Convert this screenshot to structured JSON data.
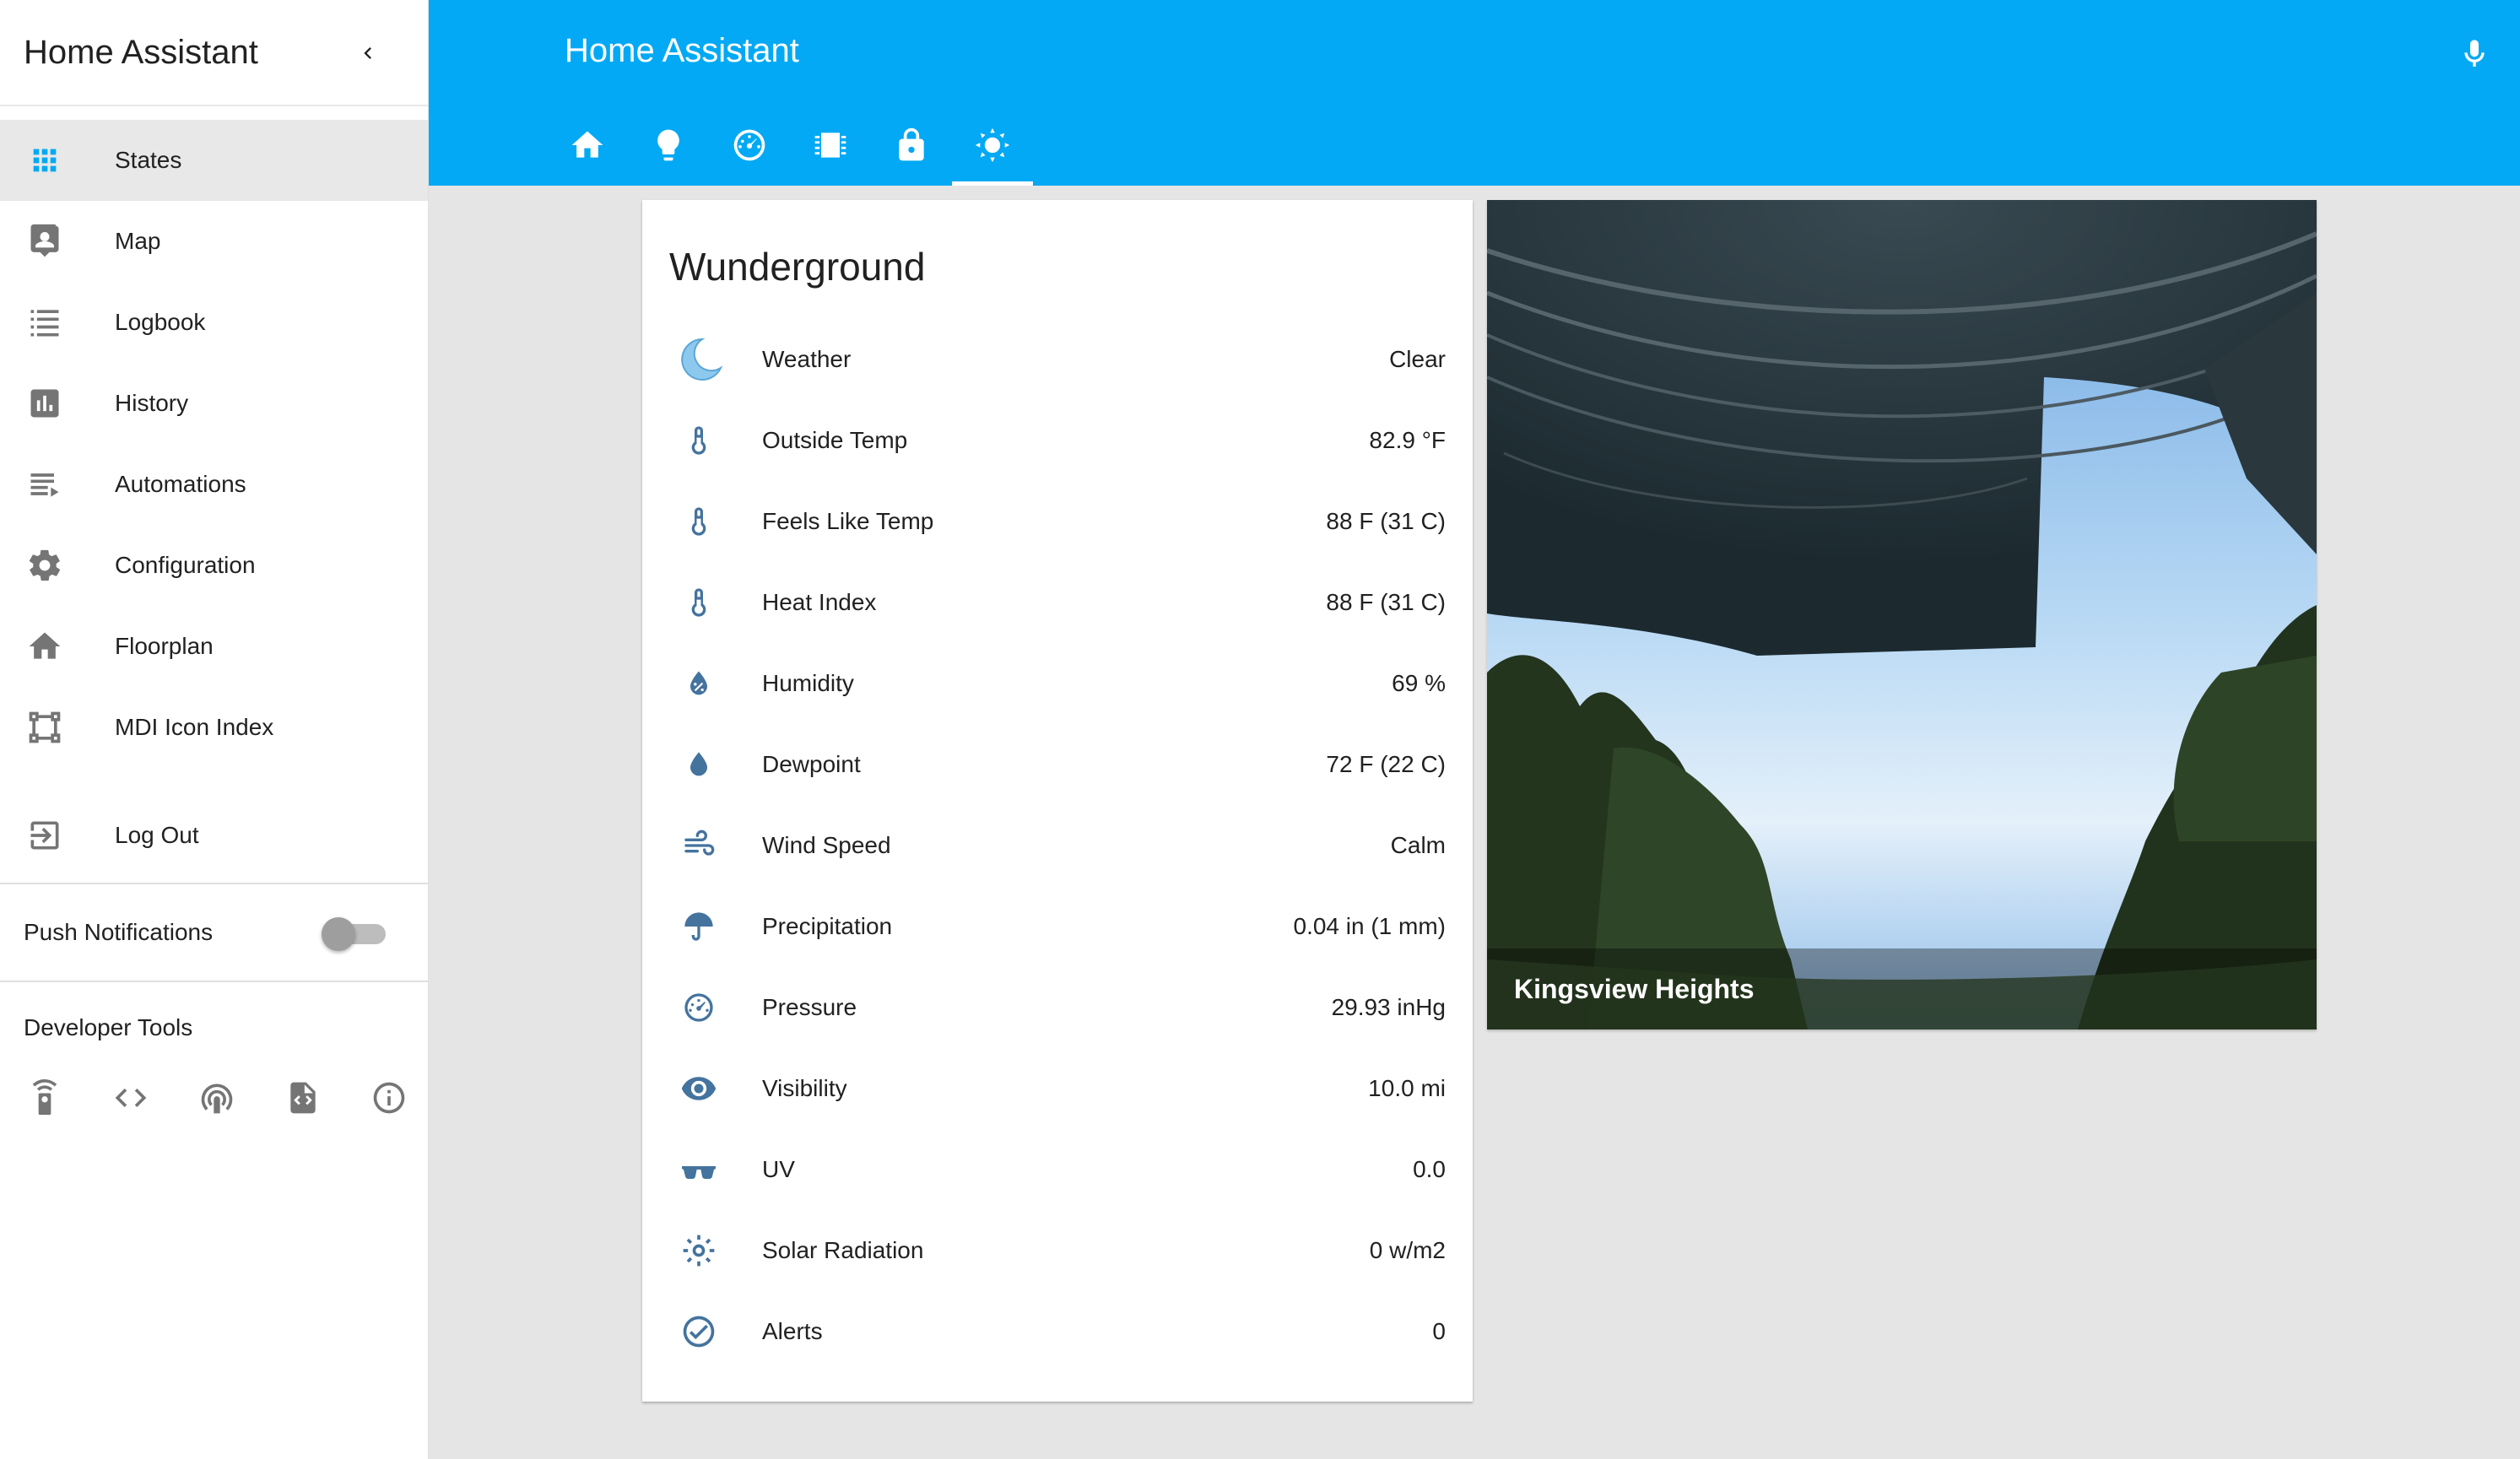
{
  "sidebar": {
    "title": "Home Assistant",
    "items": [
      {
        "label": "States",
        "icon": "apps-grid-icon",
        "active": true
      },
      {
        "label": "Map",
        "icon": "account-location-icon"
      },
      {
        "label": "Logbook",
        "icon": "format-list-bulleted-icon"
      },
      {
        "label": "History",
        "icon": "poll-box-icon"
      },
      {
        "label": "Automations",
        "icon": "playlist-play-icon"
      },
      {
        "label": "Configuration",
        "icon": "settings-gear-icon"
      },
      {
        "label": "Floorplan",
        "icon": "home-icon"
      },
      {
        "label": "MDI Icon Index",
        "icon": "vector-square-icon"
      }
    ],
    "logout_label": "Log Out",
    "push_label": "Push Notifications",
    "push_enabled": false,
    "dev_tools_title": "Developer Tools",
    "dev_tools": [
      "remote-icon",
      "code-tags-icon",
      "broadcast-icon",
      "file-xml-icon",
      "information-outline-icon"
    ]
  },
  "header": {
    "title": "Home Assistant",
    "tabs": [
      "home-icon",
      "lightbulb-icon",
      "speedometer-icon",
      "chip-icon",
      "lock-icon",
      "sun-icon"
    ],
    "active_tab": 5,
    "accent_color": "#03a9f4"
  },
  "card": {
    "title": "Wunderground",
    "rows": [
      {
        "label": "Weather",
        "value": "Clear",
        "icon": "moon-icon"
      },
      {
        "label": "Outside Temp",
        "value": "82.9 °F",
        "icon": "thermometer-icon"
      },
      {
        "label": "Feels Like Temp",
        "value": "88 F (31 C)",
        "icon": "thermometer-icon"
      },
      {
        "label": "Heat Index",
        "value": "88 F (31 C)",
        "icon": "thermometer-icon"
      },
      {
        "label": "Humidity",
        "value": "69 %",
        "icon": "water-percent-icon"
      },
      {
        "label": "Dewpoint",
        "value": "72 F (22 C)",
        "icon": "water-drop-icon"
      },
      {
        "label": "Wind Speed",
        "value": "Calm",
        "icon": "weather-windy-icon"
      },
      {
        "label": "Precipitation",
        "value": "0.04 in (1 mm)",
        "icon": "umbrella-icon"
      },
      {
        "label": "Pressure",
        "value": "29.93 inHg",
        "icon": "gauge-icon"
      },
      {
        "label": "Visibility",
        "value": "10.0 mi",
        "icon": "eye-icon"
      },
      {
        "label": "UV",
        "value": "0.0",
        "icon": "sunglasses-icon"
      },
      {
        "label": "Solar Radiation",
        "value": "0 w/m2",
        "icon": "white-balance-sunny-icon"
      },
      {
        "label": "Alerts",
        "value": "0",
        "icon": "check-circle-outline-icon"
      }
    ],
    "icon_color": "#44739e"
  },
  "camera": {
    "caption": "Kingsview Heights"
  }
}
